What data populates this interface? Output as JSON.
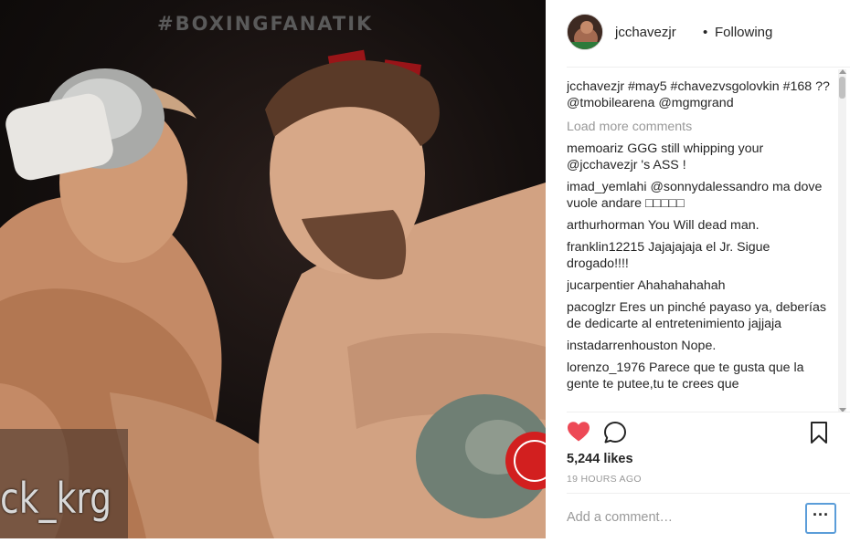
{
  "photo": {
    "watermark_top": "#BOXINGFANATIK",
    "watermark_bottom": "ck_krg"
  },
  "header": {
    "username": "jcchavezjr",
    "separator": "•",
    "follow_status": "Following"
  },
  "caption": {
    "username": "jcchavezjr",
    "text": "#may5 #chavezvsgolovkin #168 ?? @tmobilearena @mgmgrand"
  },
  "load_more": "Load more comments",
  "comments": [
    {
      "username": "memoariz",
      "text": "GGG still whipping your @jcchavezjr 's ASS !"
    },
    {
      "username": "imad_yemlahi",
      "text": "@sonnydalessandro ma dove vuole andare □□□□□"
    },
    {
      "username": "arthurhorman",
      "text": "You Will dead man."
    },
    {
      "username": "franklin12215",
      "text": "Jajajajaja el Jr. Sigue drogado!!!!"
    },
    {
      "username": "jucarpentier",
      "text": "Ahahahahahah"
    },
    {
      "username": "pacoglzr",
      "text": "Eres un pinché payaso ya, deberías de dedicarte al entretenimiento jajjaja"
    },
    {
      "username": "instadarrenhouston",
      "text": "Nope."
    },
    {
      "username": "lorenzo_1976",
      "text": "Parece que te gusta que la gente te putee,tu te crees que"
    }
  ],
  "actions": {
    "like_icon": "heart-icon",
    "comment_icon": "comment-icon",
    "save_icon": "bookmark-icon",
    "like_color": "#ed4956"
  },
  "likes": "5,244 likes",
  "timestamp": "19 HOURS AGO",
  "add_comment_placeholder": "Add a comment…",
  "more_label": "···"
}
